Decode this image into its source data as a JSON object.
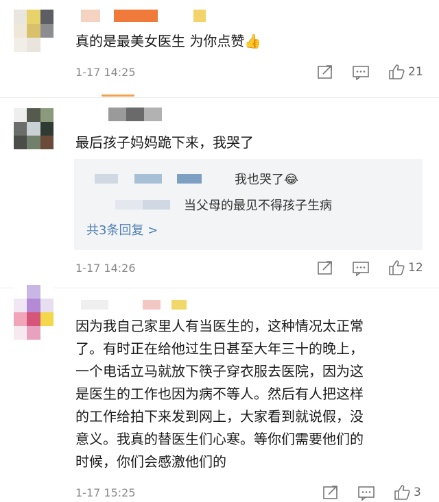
{
  "comments": [
    {
      "text": "真的是最美女医生 为你点赞👍",
      "time": "1-17 14:25",
      "likes": "21"
    },
    {
      "text": "最后孩子妈妈跪下来，我哭了",
      "time": "1-17 14:26",
      "likes": "12",
      "replies": [
        {
          "text": "我也哭了😂"
        },
        {
          "text": "当父母的最见不得孩子生病"
        }
      ],
      "more_replies": "共3条回复 >"
    },
    {
      "lines": [
        "因为我自己家里人有当医生的，这种情况太正常",
        "了。有时正在给他过生日甚至大年三十的晚上，",
        "一个电话立马就放下筷子穿衣服去医院，因为这",
        "是医生的工作也因为病不等人。然后有人把这样",
        "的工作给拍下来发到网上，大家看到就说假，没",
        "意义。我真的替医生们心寒。等你们需要他们的",
        "时候，你们会感激他们的"
      ],
      "time": "1-17 15:25",
      "likes": "3"
    }
  ],
  "icons": {
    "share": "share-icon",
    "comment": "comment-icon",
    "like": "thumbs-up-icon"
  },
  "colors": {
    "time": "#8a8a8a",
    "link": "#4d7db3",
    "accent": "#f3a04a"
  }
}
